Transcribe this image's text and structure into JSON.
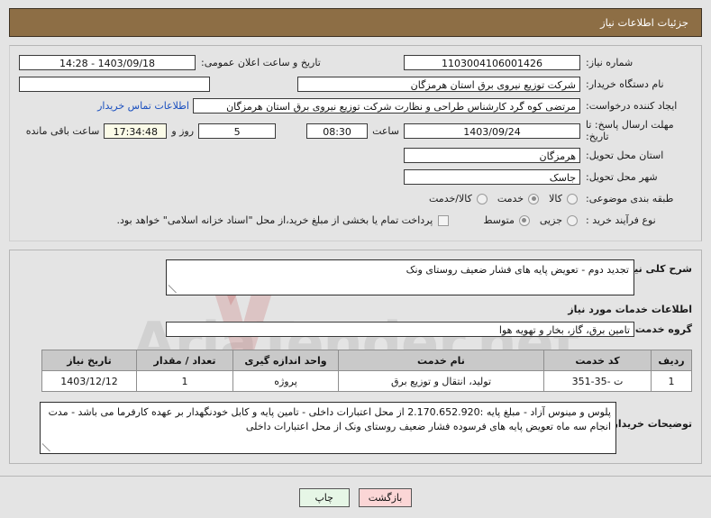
{
  "header": {
    "title": "جزئیات اطلاعات نیاز",
    "bg_color": "#8d6e45",
    "text_color": "#ffffff"
  },
  "form": {
    "need_number_label": "شماره نیاز:",
    "need_number_value": "1103004106001426",
    "public_announce_label": "تاریخ و ساعت اعلان عمومی:",
    "public_announce_value": "1403/09/18 - 14:28",
    "buyer_org_label": "نام دستگاه خریدار:",
    "buyer_org_value": "شرکت توزیع نیروی برق استان هرمزگان",
    "blank_field_value": "",
    "creator_label": "ایجاد کننده درخواست:",
    "creator_value": "مرتضی کوه گرد کارشناس طراحی و نظارت شرکت توزیع نیروی برق استان هرمزگان",
    "buyer_contact_link": "اطلاعات تماس خریدار",
    "deadline_label": "مهلت ارسال پاسخ: تا تاریخ:",
    "deadline_date": "1403/09/24",
    "time_label": "ساعت",
    "deadline_time": "08:30",
    "days_remaining": "5",
    "days_word": "روز و",
    "hours_remaining": "17:34:48",
    "remaining_suffix": "ساعت باقی مانده",
    "province_label": "استان محل تحویل:",
    "province_value": "هرمزگان",
    "city_label": "شهر محل تحویل:",
    "city_value": "جاسک",
    "category_label": "طبقه بندی موضوعی:",
    "category_options": [
      {
        "label": "کالا",
        "selected": false
      },
      {
        "label": "خدمت",
        "selected": true
      },
      {
        "label": "کالا/خدمت",
        "selected": false
      }
    ],
    "process_label": "نوع فرآیند خرید :",
    "process_options": [
      {
        "label": "جزیی",
        "selected": false
      },
      {
        "label": "متوسط",
        "selected": true
      }
    ],
    "treasury_checkbox_checked": false,
    "treasury_note": "پرداخت تمام یا بخشی از مبلغ خرید،از محل \"اسناد خزانه اسلامی\" خواهد بود."
  },
  "description": {
    "general_label": "شرح کلی نیاز:",
    "general_value": "تجدید دوم - تعویض پایه های فشار ضعیف روستای ونک",
    "services_section_title": "اطلاعات خدمات مورد نیاز",
    "service_group_label": "گروه خدمت:",
    "service_group_value": "تامین برق، گاز، بخار و تهویه هوا"
  },
  "table": {
    "headers": [
      "ردیف",
      "کد خدمت",
      "نام خدمت",
      "واحد اندازه گیری",
      "تعداد / مقدار",
      "تاریخ نیاز"
    ],
    "rows": [
      {
        "index": "1",
        "service_code": "ت -35-351",
        "service_name": "تولید، انتقال و توزیع برق",
        "unit": "پروژه",
        "quantity": "1",
        "need_date": "1403/12/12"
      }
    ]
  },
  "buyer_notes": {
    "label": "توضیحات خریدار:",
    "value": "پلوس و مینوس آزاد - مبلغ پایه :2.170.652.920  از محل اعتبارات داخلی - تامین پایه و کابل خودنگهدار بر عهده کارفرما می باشد - مدت انجام سه ماه تعویض پایه های فرسوده فشار ضعیف روستای ونک از محل اعتبارات داخلی"
  },
  "footer": {
    "back_label": "بازگشت",
    "print_label": "چاپ"
  },
  "watermark": {
    "text": "AriaTender.net"
  }
}
